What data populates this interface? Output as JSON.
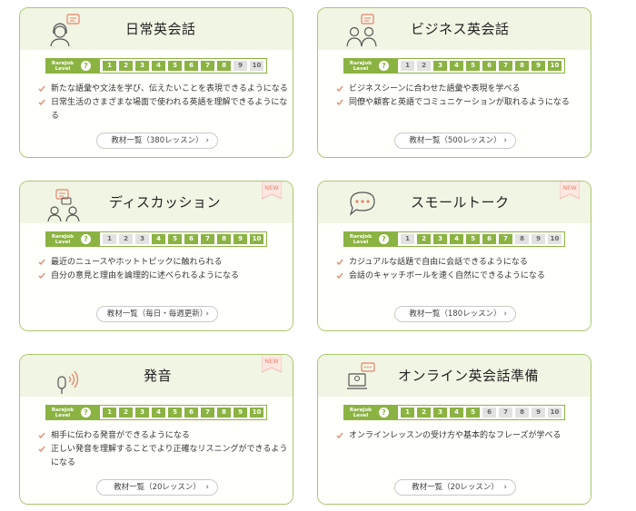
{
  "level_tag": {
    "line1": "RareJob",
    "line2": "Level",
    "help": "?"
  },
  "levels": [
    "1",
    "2",
    "3",
    "4",
    "5",
    "6",
    "7",
    "8",
    "9",
    "10"
  ],
  "new_label": "NEW",
  "colors": {
    "accent": "#8bb342",
    "header_bg": "#f1f5e3",
    "new": "#e7836a",
    "off": "#e2e2e2"
  },
  "cards": [
    {
      "title": "日常英会話",
      "icon": "woman-speech-bubble-icon",
      "new": false,
      "active": [
        1,
        2,
        3,
        4,
        5,
        6,
        7,
        8
      ],
      "points": [
        "新たな語彙や文法を学び、伝えたいことを表現できるようになる",
        "日常生活のさまざまな場面で使われる英語を理解できるようになる"
      ],
      "button": "教材一覧（380レッスン）"
    },
    {
      "title": "ビジネス英会話",
      "icon": "business-people-icon",
      "new": false,
      "active": [
        3,
        4,
        5,
        6,
        7,
        8,
        9,
        10
      ],
      "points": [
        "ビジネスシーンに合わせた語彙や表現を学べる",
        "同僚や顧客と英語でコミュニケーションが取れるようになる"
      ],
      "button": "教材一覧（500レッスン）"
    },
    {
      "title": "ディスカッション",
      "icon": "discussion-icon",
      "new": true,
      "active": [
        4,
        5,
        6,
        7,
        8,
        9,
        10
      ],
      "points": [
        "最近のニュースやホットトピックに触れられる",
        "自分の意見と理由を論理的に述べられるようになる"
      ],
      "button": "教材一覧（毎日・毎週更新）"
    },
    {
      "title": "スモールトーク",
      "icon": "chat-bubble-icon",
      "new": true,
      "active": [
        2,
        3,
        4,
        5,
        6,
        7
      ],
      "points": [
        "カジュアルな話題で自由に会話できるようになる",
        "会話のキャッチボールを速く自然にできるようになる"
      ],
      "button": "教材一覧（180レッスン）"
    },
    {
      "title": "発音",
      "icon": "microphone-icon",
      "new": true,
      "active": [
        1,
        2,
        3,
        4,
        5,
        6,
        7,
        8,
        9,
        10
      ],
      "points": [
        "相手に伝わる発音ができるようになる",
        "正しい発音を理解することでより正確なリスニングができるようになる"
      ],
      "button": "教材一覧（20レッスン）"
    },
    {
      "title": "オンライン英会話準備",
      "icon": "online-lesson-icon",
      "new": false,
      "active": [
        1,
        2,
        3,
        4,
        5
      ],
      "points": [
        "オンラインレッスンの受け方や基本的なフレーズが学べる"
      ],
      "button": "教材一覧（20レッスン）"
    }
  ]
}
